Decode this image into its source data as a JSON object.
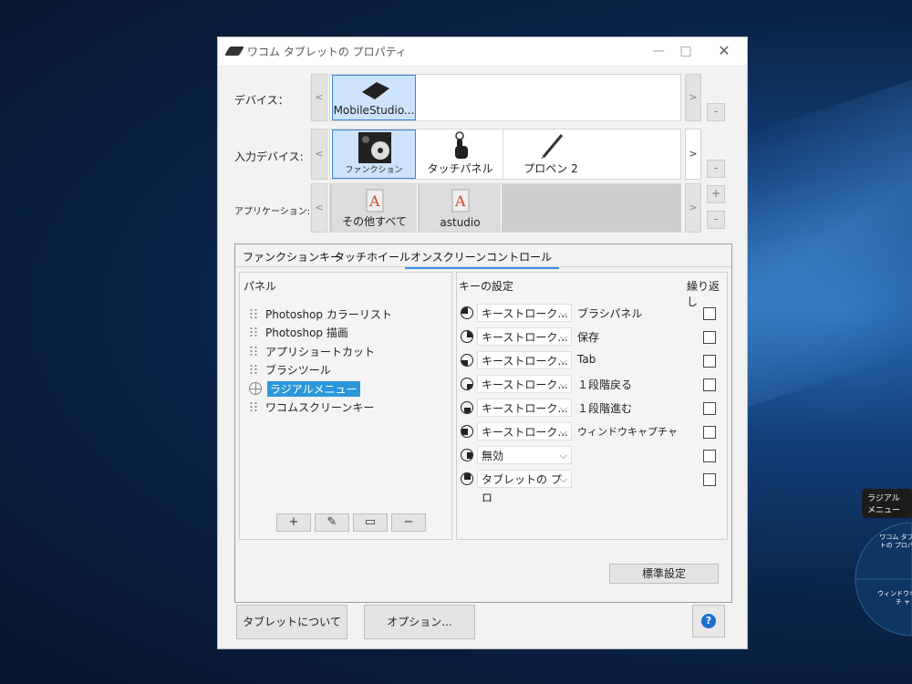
{
  "window": {
    "title": "ワコム タブレットの プロパティ",
    "minimize": "—",
    "maximize": "□",
    "close": "✕"
  },
  "rows": {
    "device": {
      "label": "デバイス：",
      "items": [
        {
          "name": "MobileStudio...",
          "icon": "tablet-icon",
          "selected": true
        }
      ]
    },
    "input": {
      "label": "入力デバイス:",
      "items": [
        {
          "name": "ファンクション",
          "icon": "function-icon",
          "selected": true
        },
        {
          "name": "タッチパネル",
          "icon": "touch-hand-icon",
          "selected": false
        },
        {
          "name": "プロペン 2",
          "icon": "pen-icon",
          "selected": false
        }
      ]
    },
    "application": {
      "label": "アプリケーション:",
      "items": [
        {
          "name": "その他すべて",
          "icon": "app-all-icon"
        },
        {
          "name": "astudio",
          "icon": "app-astudio-icon"
        }
      ]
    },
    "arrow_left": "<",
    "arrow_right": ">",
    "minus": "-",
    "plus": "+"
  },
  "tabs": [
    "ファンクションキー",
    "タッチホイール",
    "オンスクリーンコントロール"
  ],
  "active_tab": 2,
  "panel": {
    "header": "パネル",
    "items": [
      "Photoshop カラーリスト",
      "Photoshop 描画",
      "アプリショートカット",
      "ブラシツール",
      "ラジアルメニュー",
      "ワコムスクリーンキー"
    ],
    "selected_index": 4,
    "buttons": [
      "+",
      "✎",
      "▭",
      "−"
    ]
  },
  "keys": {
    "header": "キーの設定",
    "repeat_header": "繰り返し",
    "rows": [
      {
        "dir": "up",
        "action": "キーストローク...",
        "assign": "ブラシパネル"
      },
      {
        "dir": "right",
        "action": "キーストローク...",
        "assign": "保存"
      },
      {
        "dir": "down",
        "action": "キーストローク...",
        "assign": "Tab"
      },
      {
        "dir": "left",
        "action": "キーストローク...",
        "assign": "１段階戻る"
      },
      {
        "dir": "up",
        "action": "キーストローク...",
        "assign": "１段階進む"
      },
      {
        "dir": "right",
        "action": "キーストローク...",
        "assign": "ウィンドウキャプチャ"
      },
      {
        "dir": "down",
        "action": "無効",
        "assign": ""
      },
      {
        "dir": "left",
        "action": "タブレットの プロ",
        "assign": ""
      }
    ],
    "chevron": "⌵"
  },
  "default_button": "標準設定",
  "bottom": {
    "about": "タブレットについて",
    "options": "オプション...",
    "help": "?"
  },
  "desktop": {
    "popup": "ラジアルメニュー",
    "radial": [
      "ワコム タブレッ トの プロパティ",
      "ウィンドウキャプチ ャ"
    ]
  }
}
